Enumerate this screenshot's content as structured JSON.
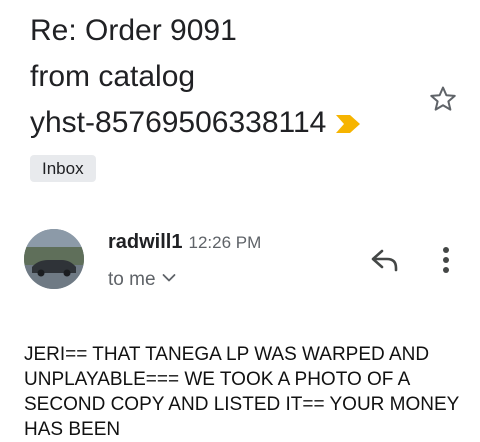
{
  "email": {
    "subject_lines": [
      "Re: Order 9091",
      "from catalog",
      "yhst-85769506338114"
    ],
    "label": "Inbox",
    "sender_name": "radwill1",
    "time": "12:26 PM",
    "recipient": "to me",
    "body": "JERI== THAT TANEGA LP WAS WARPED AND UNPLAYABLE=== WE TOOK A PHOTO OF A SECOND COPY AND LISTED IT==  YOUR MONEY HAS BEEN"
  },
  "icons": {
    "importance": "importance-marker-icon",
    "star": "star-outline-icon",
    "reply": "reply-icon",
    "more": "more-vert-icon",
    "recipient_details": "chevron-down-icon"
  },
  "colors": {
    "importance_marker": "#f6b400",
    "label_chip_bg": "#e8eaed",
    "secondary_text": "#5f6368"
  }
}
